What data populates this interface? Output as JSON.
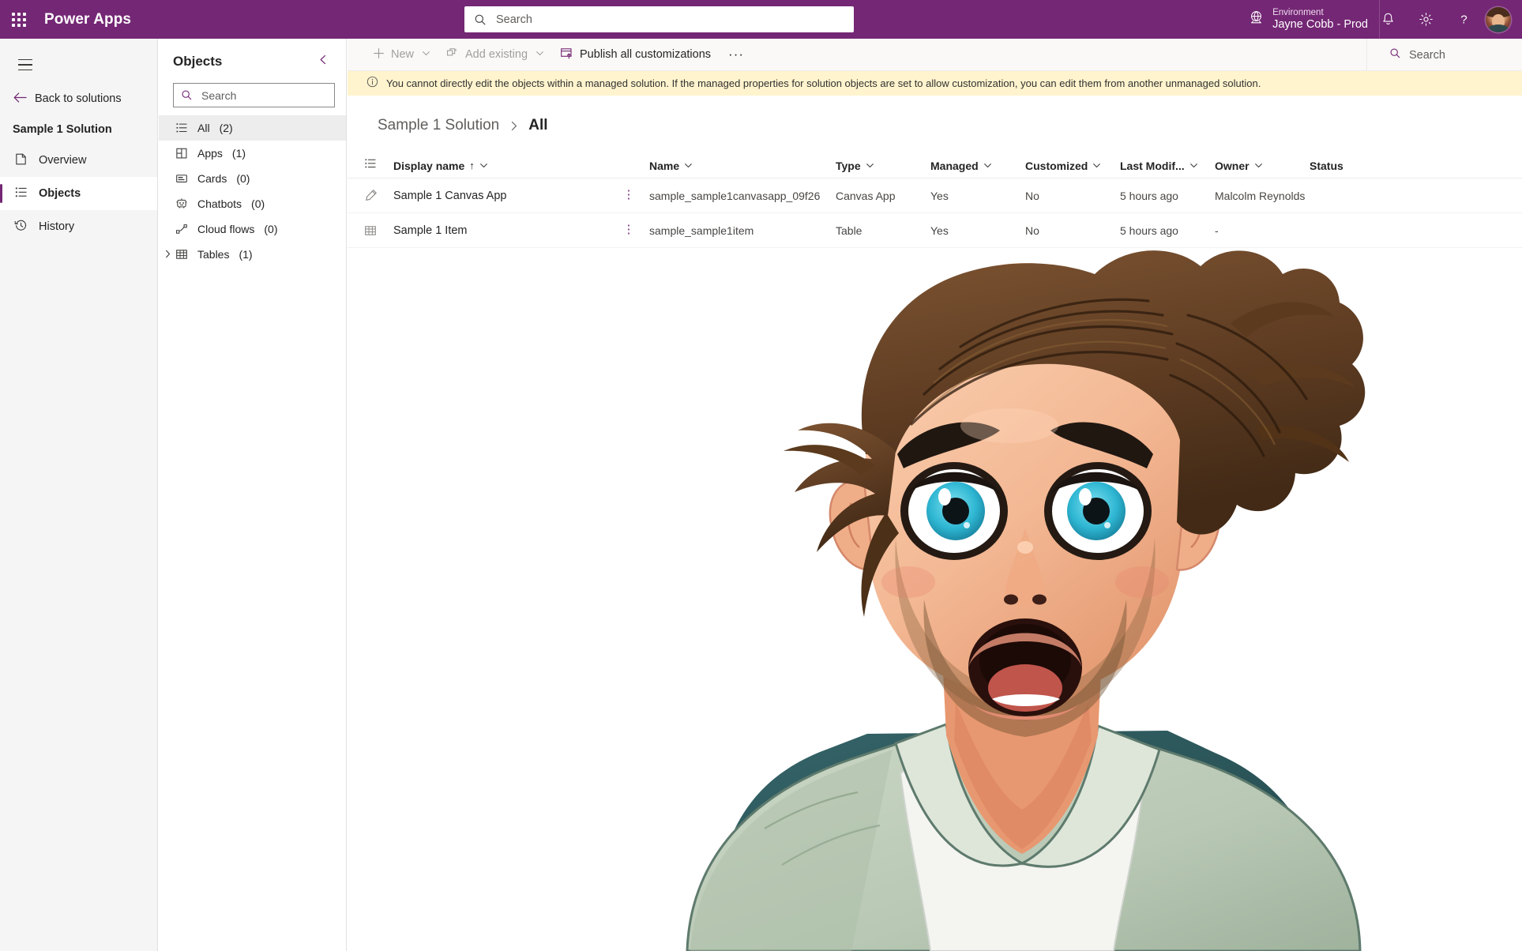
{
  "header": {
    "app_launcher": "app-launcher",
    "brand": "Power Apps",
    "search_placeholder": "Search",
    "environment_label": "Environment",
    "environment_name": "Jayne Cobb - Prod",
    "icons": [
      "notification-bell-icon",
      "settings-gear-icon",
      "help-question-icon"
    ],
    "avatar": "user-avatar"
  },
  "leftnav": {
    "back_label": "Back to solutions",
    "solution_title": "Sample 1 Solution",
    "items": [
      {
        "label": "Overview",
        "icon": "overview-icon",
        "active": false
      },
      {
        "label": "Objects",
        "icon": "objects-icon",
        "active": true
      },
      {
        "label": "History",
        "icon": "history-clock-icon",
        "active": false
      }
    ]
  },
  "objects_panel": {
    "title": "Objects",
    "search_placeholder": "Search",
    "items": [
      {
        "label": "All",
        "count": "(2)",
        "icon": "list-all-icon",
        "selected": true,
        "expandable": false
      },
      {
        "label": "Apps",
        "count": "(1)",
        "icon": "apps-grid-icon",
        "selected": false,
        "expandable": false
      },
      {
        "label": "Cards",
        "count": "(0)",
        "icon": "card-icon",
        "selected": false,
        "expandable": false
      },
      {
        "label": "Chatbots",
        "count": "(0)",
        "icon": "chatbot-icon",
        "selected": false,
        "expandable": false
      },
      {
        "label": "Cloud flows",
        "count": "(0)",
        "icon": "cloud-flow-icon",
        "selected": false,
        "expandable": false
      },
      {
        "label": "Tables",
        "count": "(1)",
        "icon": "table-icon",
        "selected": false,
        "expandable": true
      }
    ]
  },
  "command_bar": {
    "new_label": "New",
    "add_existing_label": "Add existing",
    "publish_label": "Publish all customizations",
    "overflow_label": "···",
    "search_placeholder": "Search"
  },
  "banner": {
    "icon": "info-circle-icon",
    "text": "You cannot directly edit the objects within a managed solution. If the managed properties for solution objects are set to allow customization, you can edit them from another unmanaged solution."
  },
  "breadcrumb": {
    "parent": "Sample 1 Solution",
    "separator": "chevron-right-icon",
    "current": "All"
  },
  "table": {
    "columns": [
      {
        "key": "display_name",
        "label": "Display name",
        "sorted": "↑"
      },
      {
        "key": "name",
        "label": "Name"
      },
      {
        "key": "type",
        "label": "Type"
      },
      {
        "key": "managed",
        "label": "Managed"
      },
      {
        "key": "customized",
        "label": "Customized"
      },
      {
        "key": "last_modified",
        "label": "Last Modif..."
      },
      {
        "key": "owner",
        "label": "Owner"
      },
      {
        "key": "status",
        "label": "Status"
      }
    ],
    "rows": [
      {
        "icon": "canvas-app-pencil-icon",
        "display_name": "Sample 1 Canvas App",
        "name": "sample_sample1canvasapp_09f26",
        "type": "Canvas App",
        "managed": "Yes",
        "customized": "No",
        "last_modified": "5 hours ago",
        "owner": "Malcolm Reynolds",
        "status": ""
      },
      {
        "icon": "table-grid-icon",
        "display_name": "Sample 1 Item",
        "name": "sample_sample1item",
        "type": "Table",
        "managed": "Yes",
        "customized": "No",
        "last_modified": "5 hours ago",
        "owner": "-",
        "status": ""
      }
    ]
  },
  "illustration": {
    "name": "surprised-man-cartoon-illustration",
    "colors": {
      "hair": "#6b4327",
      "hair_dark": "#4a2c16",
      "skin": "#f2b58f",
      "skin_shadow": "#e09470",
      "eye_iris": "#2eb8d4",
      "eye_white": "#ffffff",
      "mouth": "#b4443c",
      "jacket": "#bdcdbb",
      "jacket_shadow": "#a3b5a2",
      "shirt": "#f2f2ef",
      "chair": "#2f5a5e"
    }
  },
  "theme": {
    "brand_purple": "#742774",
    "banner_yellow": "#fff4ce",
    "nav_bg": "#f5f5f5"
  }
}
